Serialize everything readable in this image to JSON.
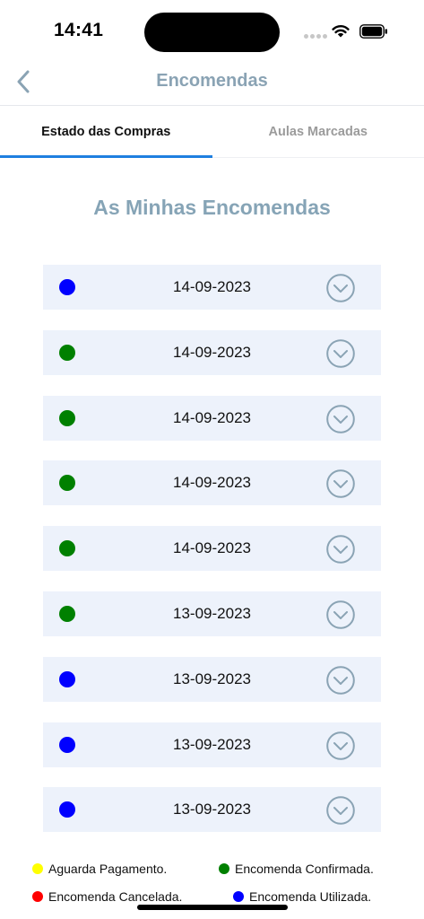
{
  "status_bar": {
    "time": "14:41"
  },
  "nav": {
    "title": "Encomendas"
  },
  "tabs": [
    {
      "label": "Estado das Compras",
      "active": true
    },
    {
      "label": "Aulas Marcadas",
      "active": false
    }
  ],
  "section_title": "As Minhas Encomendas",
  "colors": {
    "blue": "#0000ff",
    "green": "#008000",
    "yellow": "#ffff00",
    "red": "#ff0000",
    "row_background": "#edf2fb",
    "accent": "#8aa3b4",
    "tab_indicator": "#1f7fe0"
  },
  "orders": [
    {
      "date": "14-09-2023",
      "status_color": "#0000ff"
    },
    {
      "date": "14-09-2023",
      "status_color": "#008000"
    },
    {
      "date": "14-09-2023",
      "status_color": "#008000"
    },
    {
      "date": "14-09-2023",
      "status_color": "#008000"
    },
    {
      "date": "14-09-2023",
      "status_color": "#008000"
    },
    {
      "date": "13-09-2023",
      "status_color": "#008000"
    },
    {
      "date": "13-09-2023",
      "status_color": "#0000ff"
    },
    {
      "date": "13-09-2023",
      "status_color": "#0000ff"
    },
    {
      "date": "13-09-2023",
      "status_color": "#0000ff"
    }
  ],
  "legend": [
    {
      "label": "Aguarda Pagamento.",
      "color": "#ffff00"
    },
    {
      "label": "Encomenda Confirmada.",
      "color": "#008000"
    },
    {
      "label": "Encomenda Cancelada.",
      "color": "#ff0000"
    },
    {
      "label": "Encomenda Utilizada.",
      "color": "#0000ff"
    }
  ]
}
